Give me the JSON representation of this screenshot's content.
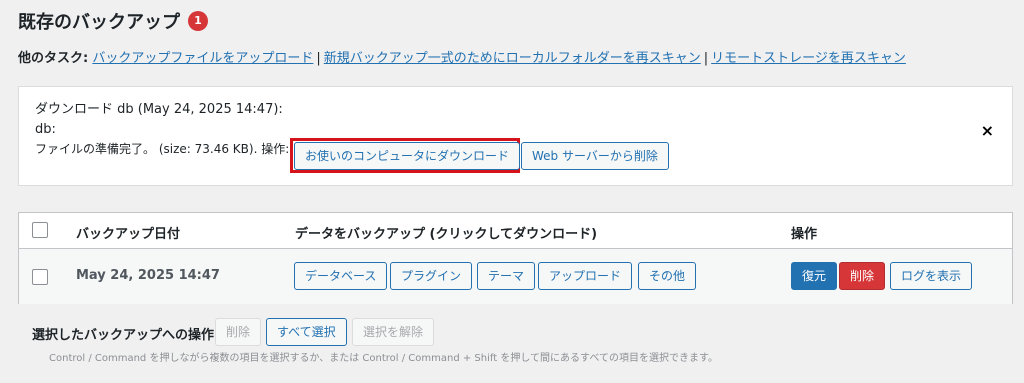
{
  "header": {
    "title": "既存のバックアップ",
    "count": "1"
  },
  "other_tasks": {
    "label": "他のタスク:",
    "links": [
      "バックアップファイルをアップロード",
      "新規バックアップ一式のためにローカルフォルダーを再スキャン",
      "リモートストレージを再スキャン"
    ],
    "separator": "|"
  },
  "download_box": {
    "title": "ダウンロード db (May 24, 2025 14:47):",
    "name": "db:",
    "status": "ファイルの準備完了。 (size: 73.46 KB). 操作:",
    "download_button": "お使いのコンピュータにダウンロード",
    "delete_button": "Web サーバーから削除",
    "close": "×",
    "highlight_color": "#d6131a"
  },
  "table": {
    "headers": [
      "バックアップ日付",
      "データをバックアップ (クリックしてダウンロード)",
      "操作"
    ],
    "rows": [
      {
        "date": "May 24, 2025 14:47",
        "components": [
          "データベース",
          "プラグイン",
          "テーマ",
          "アップロード",
          "その他"
        ],
        "actions": [
          "復元",
          "削除",
          "ログを表示"
        ]
      }
    ]
  },
  "bulk": {
    "title": "選択したバックアップへの操作",
    "delete": "削除",
    "select_all": "すべて選択",
    "deselect": "選択を解除",
    "hint": "Control / Command を押しながら複数の項目を選択するか、または Control / Command + Shift を押して間にあるすべての項目を選択できます。"
  },
  "colors": {
    "primary": "#2271b1",
    "danger": "#d63638",
    "background": "#f0f0f1"
  }
}
